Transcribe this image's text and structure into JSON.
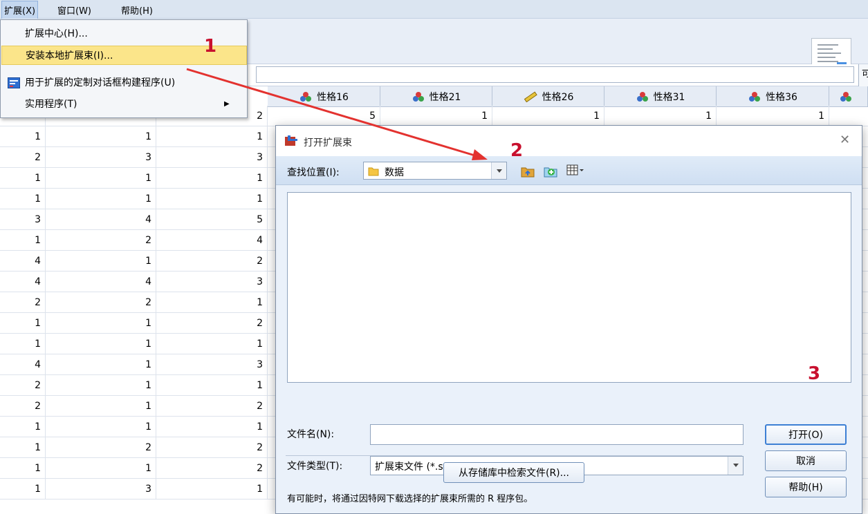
{
  "menubar": {
    "items": [
      {
        "label": "扩展(X)",
        "active": true
      },
      {
        "label": "窗口(W)",
        "active": false
      },
      {
        "label": "帮助(H)",
        "active": false
      }
    ]
  },
  "dropdown": {
    "items": [
      {
        "label": "扩展中心(H)..."
      },
      {
        "label": "安装本地扩展束(I)...",
        "highlighted": true
      },
      {
        "label": "用于扩展的定制对话框构建程序(U)"
      },
      {
        "label": "实用程序(T)",
        "submenu": true
      }
    ],
    "submenu_arrow": "▶"
  },
  "cellbar_edge_text": "可",
  "grid": {
    "headers": [
      "性格16",
      "性格21",
      "性格26",
      "性格31",
      "性格36"
    ],
    "header_icons": [
      "nominal-icon",
      "nominal-icon",
      "scale-ruler-icon",
      "nominal-icon",
      "nominal-icon"
    ],
    "rows": [
      [
        "",
        "",
        "2",
        "5",
        "1",
        "1",
        "1",
        "1"
      ],
      [
        "1",
        "1",
        "1",
        "",
        "",
        "",
        "",
        ""
      ],
      [
        "2",
        "3",
        "3",
        "",
        "",
        "",
        "",
        ""
      ],
      [
        "1",
        "1",
        "1",
        "",
        "",
        "",
        "",
        ""
      ],
      [
        "1",
        "1",
        "1",
        "",
        "",
        "",
        "",
        ""
      ],
      [
        "3",
        "4",
        "5",
        "",
        "",
        "",
        "",
        ""
      ],
      [
        "1",
        "2",
        "4",
        "",
        "",
        "",
        "",
        ""
      ],
      [
        "4",
        "1",
        "2",
        "",
        "",
        "",
        "",
        ""
      ],
      [
        "4",
        "4",
        "3",
        "",
        "",
        "",
        "",
        ""
      ],
      [
        "2",
        "2",
        "1",
        "",
        "",
        "",
        "",
        ""
      ],
      [
        "1",
        "1",
        "2",
        "",
        "",
        "",
        "",
        ""
      ],
      [
        "1",
        "1",
        "1",
        "",
        "",
        "",
        "",
        ""
      ],
      [
        "4",
        "1",
        "3",
        "",
        "",
        "",
        "",
        ""
      ],
      [
        "2",
        "1",
        "1",
        "",
        "",
        "",
        "",
        ""
      ],
      [
        "2",
        "1",
        "2",
        "",
        "",
        "",
        "",
        ""
      ],
      [
        "1",
        "1",
        "1",
        "",
        "",
        "",
        "",
        ""
      ],
      [
        "1",
        "2",
        "2",
        "",
        "",
        "",
        "",
        ""
      ],
      [
        "1",
        "1",
        "2",
        "",
        "",
        "",
        "",
        ""
      ],
      [
        "1",
        "3",
        "1",
        "",
        "",
        "",
        "",
        ""
      ]
    ]
  },
  "dialog": {
    "title": "打开扩展束",
    "close": "✕",
    "look_in_label": "查找位置(I):",
    "look_in_value": "数据",
    "filename_label": "文件名(N):",
    "filename_value": "",
    "filetype_label": "文件类型(T):",
    "filetype_value": "扩展束文件 (*.spe)",
    "buttons": {
      "open": "打开(O)",
      "cancel": "取消",
      "help": "帮助(H)",
      "retrieve": "从存储库中检索文件(R)..."
    },
    "note": "有可能时，将通过因特网下载选择的扩展束所需的 R 程序包。"
  },
  "annotations": [
    "1",
    "2",
    "3"
  ],
  "colors": {
    "annotation": "#c8102e",
    "menu_highlight": "#fbe58a",
    "dialog_body": "#eaf1fa",
    "grid_header": "#e6ecf5"
  }
}
